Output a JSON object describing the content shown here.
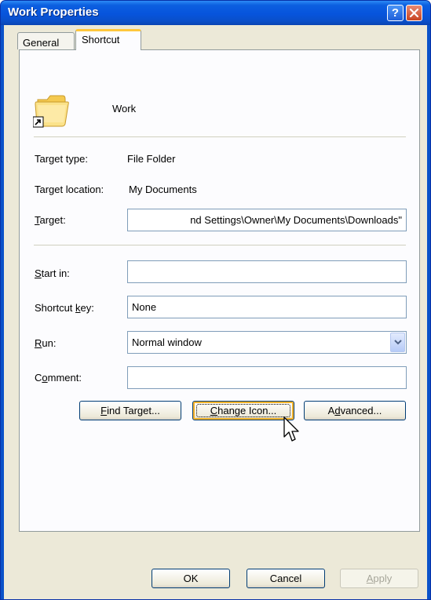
{
  "window": {
    "title": "Work Properties",
    "help_glyph": "?",
    "colors": {
      "titlebar": "#0754dc",
      "client": "#ece9d8",
      "accent_tab": "#ffc73c"
    }
  },
  "tabs": [
    {
      "label": "General",
      "selected": false
    },
    {
      "label": "Shortcut",
      "selected": true
    }
  ],
  "header": {
    "name": "Work",
    "icon": "folder-shortcut-icon"
  },
  "info": {
    "target_type_label": "Target type:",
    "target_type_value": "File Folder",
    "target_location_label": "Target location:",
    "target_location_value": "My Documents"
  },
  "fields": {
    "target_label_prefix": "",
    "target_label_key": "T",
    "target_label_rest": "arget:",
    "target_value": "nd Settings\\Owner\\My Documents\\Downloads\"",
    "start_in_label_key": "S",
    "start_in_label_rest": "tart in:",
    "start_in_value": "",
    "shortcut_key_label_prefix": "Shortcut ",
    "shortcut_key_label_key": "k",
    "shortcut_key_label_rest": "ey:",
    "shortcut_key_value": "None",
    "run_label_key": "R",
    "run_label_rest": "un:",
    "run_value": "Normal window",
    "comment_label_prefix": "C",
    "comment_label_key": "o",
    "comment_label_rest": "mment:",
    "comment_value": ""
  },
  "actions": {
    "find_target_key": "F",
    "find_target_rest": "ind Target...",
    "change_icon_key": "C",
    "change_icon_rest": "hange Icon...",
    "advanced_prefix": "A",
    "advanced_key": "d",
    "advanced_rest": "vanced..."
  },
  "footer": {
    "ok_label": "OK",
    "cancel_label": "Cancel",
    "apply_key": "A",
    "apply_rest": "pply"
  }
}
